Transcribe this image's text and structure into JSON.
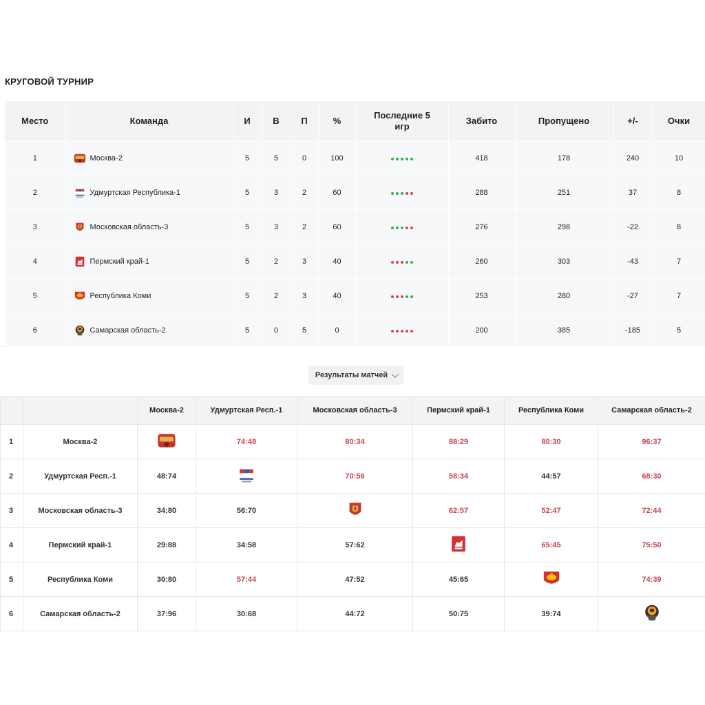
{
  "title": "КРУГОВОЙ ТУРНИР",
  "standings": {
    "headers": {
      "place": "Место",
      "team": "Команда",
      "games": "И",
      "wins": "В",
      "losses": "П",
      "percent": "%",
      "last5": "Последние 5 игр",
      "scored": "Забито",
      "conceded": "Пропущено",
      "diff": "+/-",
      "points": "Очки"
    },
    "rows": [
      {
        "place": "1",
        "team": "Москва-2",
        "logo": "moscow-logo",
        "games": "5",
        "wins": "5",
        "losses": "0",
        "percent": "100",
        "last5": [
          "w",
          "w",
          "w",
          "w",
          "w"
        ],
        "scored": "418",
        "conceded": "178",
        "diff": "240",
        "points": "10"
      },
      {
        "place": "2",
        "team": "Удмуртская Республика-1",
        "logo": "udmurtia-logo",
        "games": "5",
        "wins": "3",
        "losses": "2",
        "percent": "60",
        "last5": [
          "w",
          "w",
          "w",
          "l",
          "l"
        ],
        "scored": "288",
        "conceded": "251",
        "diff": "37",
        "points": "8"
      },
      {
        "place": "3",
        "team": "Московская область-3",
        "logo": "moscow-region-logo",
        "games": "5",
        "wins": "3",
        "losses": "2",
        "percent": "60",
        "last5": [
          "w",
          "w",
          "w",
          "l",
          "l"
        ],
        "scored": "276",
        "conceded": "298",
        "diff": "-22",
        "points": "8"
      },
      {
        "place": "4",
        "team": "Пермский край-1",
        "logo": "perm-logo",
        "games": "5",
        "wins": "2",
        "losses": "3",
        "percent": "40",
        "last5": [
          "l",
          "l",
          "l",
          "w",
          "w"
        ],
        "scored": "260",
        "conceded": "303",
        "diff": "-43",
        "points": "7"
      },
      {
        "place": "5",
        "team": "Республика Коми",
        "logo": "komi-logo",
        "games": "5",
        "wins": "2",
        "losses": "3",
        "percent": "40",
        "last5": [
          "l",
          "l",
          "l",
          "w",
          "w"
        ],
        "scored": "253",
        "conceded": "280",
        "diff": "-27",
        "points": "7"
      },
      {
        "place": "6",
        "team": "Самарская область-2",
        "logo": "samara-logo",
        "games": "5",
        "wins": "0",
        "losses": "5",
        "percent": "0",
        "last5": [
          "l",
          "l",
          "l",
          "l",
          "l"
        ],
        "scored": "200",
        "conceded": "385",
        "diff": "-185",
        "points": "5"
      }
    ]
  },
  "results_button": "Результаты матчей",
  "matrix": {
    "columns": [
      "Москва-2",
      "Удмуртская Респ.-1",
      "Московская область-3",
      "Пермский край-1",
      "Республика Коми",
      "Самарская область-2"
    ],
    "rows": [
      {
        "idx": "1",
        "team": "Москва-2",
        "cells": [
          "",
          "74:48",
          "80:34",
          "88:29",
          "80:30",
          "96:37"
        ]
      },
      {
        "idx": "2",
        "team": "Удмуртская Респ.-1",
        "cells": [
          "48:74",
          "",
          "70:56",
          "58:34",
          "44:57",
          "68:30"
        ]
      },
      {
        "idx": "3",
        "team": "Московская область-3",
        "cells": [
          "34:80",
          "56:70",
          "",
          "62:57",
          "52:47",
          "72:44"
        ]
      },
      {
        "idx": "4",
        "team": "Пермский край-1",
        "cells": [
          "29:88",
          "34:58",
          "57:62",
          "",
          "65:45",
          "75:50"
        ]
      },
      {
        "idx": "5",
        "team": "Республика Коми",
        "cells": [
          "30:80",
          "57:44",
          "47:52",
          "45:65",
          "",
          "74:39"
        ]
      },
      {
        "idx": "6",
        "team": "Самарская область-2",
        "cells": [
          "37:96",
          "30:68",
          "44:72",
          "50:75",
          "39:74",
          ""
        ]
      }
    ]
  },
  "colors": {
    "win": "#c8414b",
    "win_dot": "#36b04a",
    "loss_dot": "#d64550",
    "header_bg": "#f2f3f4",
    "row_bg": "#f7f8f9"
  }
}
